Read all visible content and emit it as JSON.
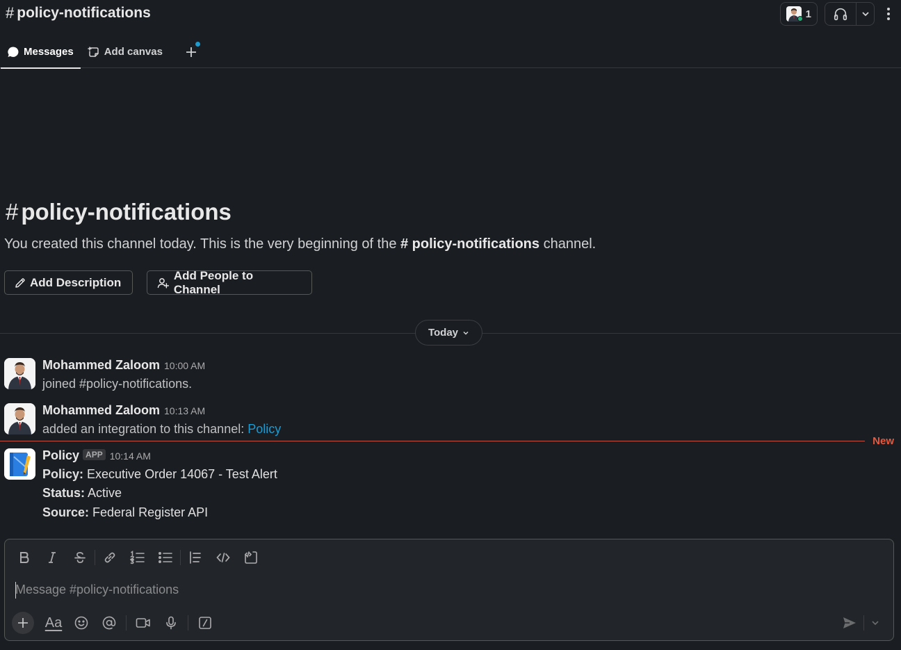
{
  "header": {
    "hash": "#",
    "channel_name": "policy-notifications",
    "member_count": "1"
  },
  "tabs": [
    {
      "label": "Messages"
    },
    {
      "label": "Add canvas"
    }
  ],
  "intro": {
    "hash": "#",
    "title": "policy-notifications",
    "text_before": "You created this channel today. This is the very beginning of the ",
    "channel_ref": "# policy-notifications",
    "text_after": " channel.",
    "add_description_label": "Add Description",
    "add_people_label": "Add People to Channel"
  },
  "date_divider": {
    "label": "Today"
  },
  "messages": [
    {
      "author": "Mohammed Zaloom",
      "time": "10:00 AM",
      "text": "joined #policy-notifications."
    },
    {
      "author": "Mohammed Zaloom",
      "time": "10:13 AM",
      "text": "added an integration to this channel: ",
      "link": "Policy"
    },
    {
      "author": "Policy",
      "badge": "APP",
      "time": "10:14 AM",
      "lines": [
        {
          "label": "Policy:",
          "value": " Executive Order 14067 - Test Alert"
        },
        {
          "label": "Status:",
          "value": " Active"
        },
        {
          "label": "Source:",
          "value": " Federal Register API"
        }
      ]
    }
  ],
  "new_marker": "New",
  "composer": {
    "placeholder": "Message #policy-notifications",
    "aa_label": "Aa"
  },
  "colors": {
    "background": "#1a1d21",
    "link": "#1d9bd1",
    "new_marker": "#e5593f",
    "presence": "#2bac76"
  }
}
